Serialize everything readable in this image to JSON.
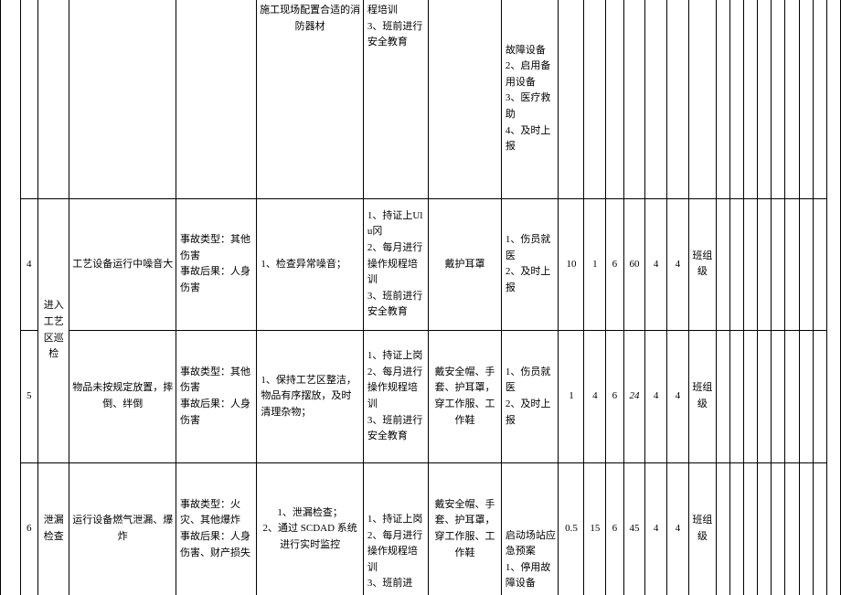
{
  "col_area": "进入工艺区巡检",
  "row_top": {
    "c4": "施工现场配置合适的消防器材",
    "c5": "程培训\n3、班前进行安全教育",
    "c7": "故障设备\n2、启用备用设备\n3、医疗救助\n4、及时上报"
  },
  "row4": {
    "no": "4",
    "desc": "工艺设备运行中噪音大",
    "type": "事故类型：其他伤害\n事故后果：人身伤害",
    "eng": "1、检查异常噪音；",
    "mgmt": "1、持证上Ulu冈\n2、每月进行操作规程培训\n3、班前进行安全教育",
    "ppe": "戴护耳罩",
    "emerg": "1、伤员就医\n2、及时上报",
    "v1": "10",
    "v2": "1",
    "v3": "6",
    "v4": "60",
    "v5": "4",
    "v6": "4",
    "level": "班组级"
  },
  "row5": {
    "no": "5",
    "desc": "物品未按规定放置，摔倒、绊倒",
    "type": "事故类型：其他伤害\n事故后果：人身伤害",
    "eng": "1、保持工艺区整洁，物品有序摆放，及时清理杂物；",
    "mgmt": "1、持证上岗\n2、每月进行操作规程培训\n3、班前进行安全教育",
    "ppe": "戴安全帽、手套、护耳罩，穿工作服、工作鞋",
    "emerg": "1、伤员就医\n2、及时上报",
    "v1": "1",
    "v2": "4",
    "v3": "6",
    "v4": "24",
    "v5": "4",
    "v6": "4",
    "level": "班组级"
  },
  "row6": {
    "no": "6",
    "area": "泄漏检查",
    "desc": "运行设备燃气泄漏、爆炸",
    "type": "事故类型：火灾、其他爆炸\n事故后果：人身伤害、财产损失",
    "eng": "1、泄漏检查；\n2、通过 SCDAD 系统进行实时监控",
    "mgmt": "1、持证上岗\n2、每月进行操作规程培训\n3、班前进",
    "ppe": "戴安全帽、手套、护耳罩，穿工作服、工作鞋",
    "emerg": "启动场站应急预案\n1、停用故障设备",
    "v1": "0.5",
    "v2": "15",
    "v3": "6",
    "v4": "45",
    "v5": "4",
    "v6": "4",
    "level": "班组级"
  }
}
